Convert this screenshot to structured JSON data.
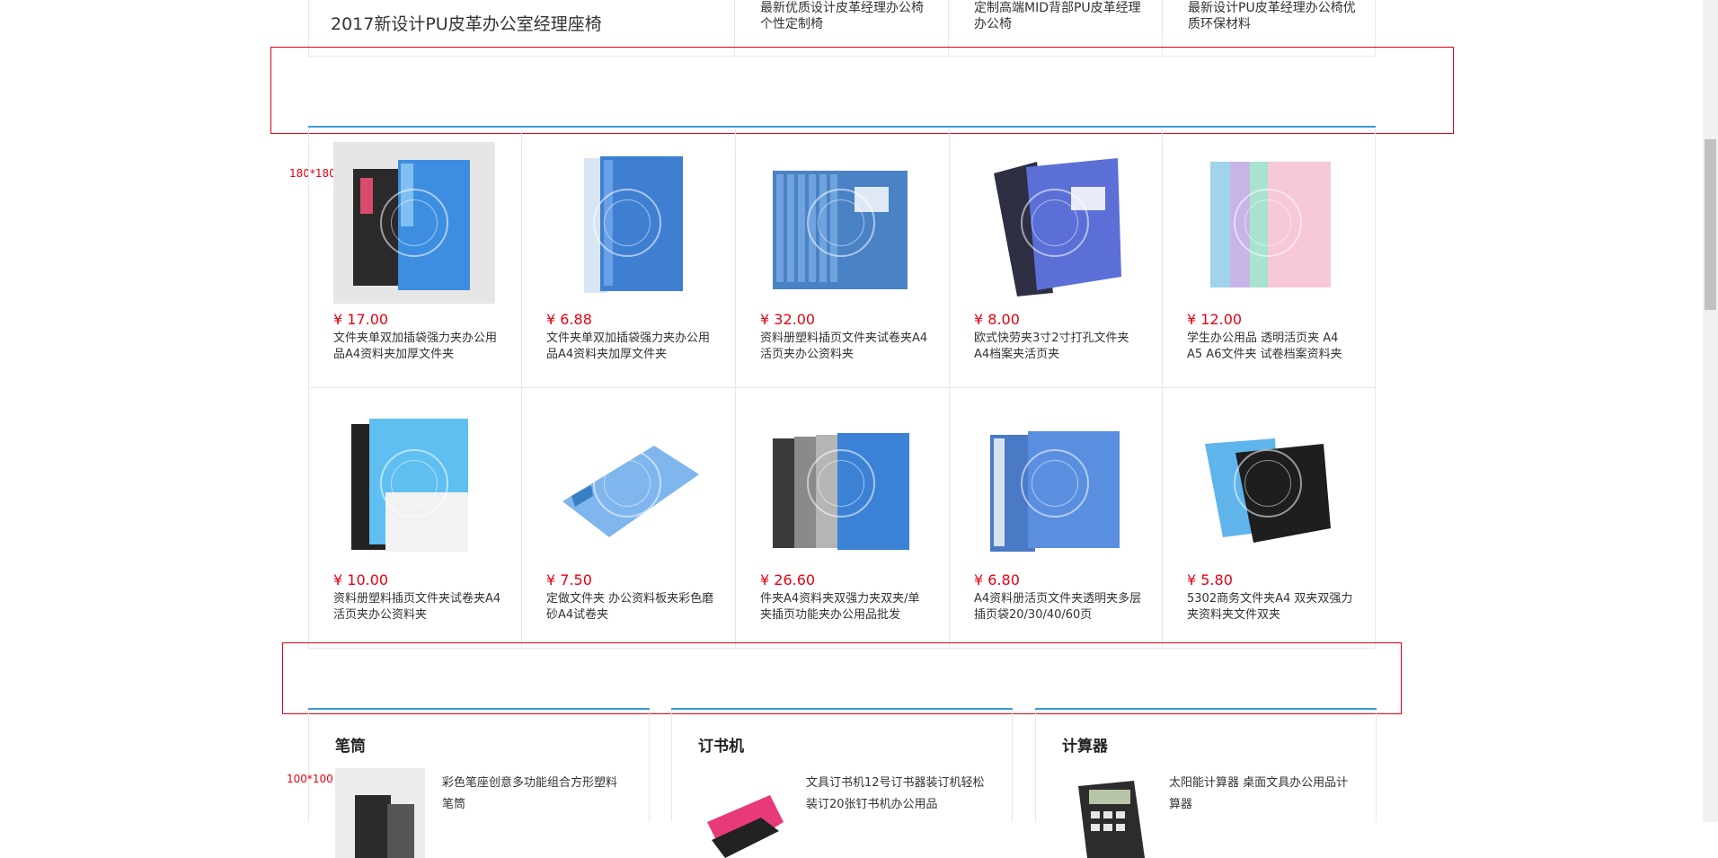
{
  "top_row": {
    "main_title": "2017新设计PU皮革办公室经理座椅",
    "items": [
      "最新优质设计皮革经理办公椅个性定制椅",
      "定制高端MID背部PU皮革经理办公椅",
      "最新设计PU皮革经理办公椅优质环保材料"
    ]
  },
  "labels": {
    "big": "180*180",
    "small": "100*100"
  },
  "products": [
    {
      "price": "¥ 17.00",
      "title": "文件夹单双加插袋强力夹办公用品A4资料夹加厚文件夹"
    },
    {
      "price": "¥ 6.88",
      "title": "文件夹单双加插袋强力夹办公用品A4资料夹加厚文件夹"
    },
    {
      "price": "¥ 32.00",
      "title": "资料册塑料插页文件夹试卷夹A4活页夹办公资料夹"
    },
    {
      "price": "¥ 8.00",
      "title": "欧式快劳夹3寸2寸打孔文件夹A4档案夹活页夹"
    },
    {
      "price": "¥ 12.00",
      "title": "学生办公用品 透明活页夹 A4 A5 A6文件夹 试卷档案资料夹"
    },
    {
      "price": "¥ 10.00",
      "title": "资料册塑料插页文件夹试卷夹A4活页夹办公资料夹"
    },
    {
      "price": "¥ 7.50",
      "title": "定做文件夹 办公资料板夹彩色磨砂A4试卷夹"
    },
    {
      "price": "¥ 26.60",
      "title": "件夹A4资料夹双强力夹双夹/单夹插页功能夹办公用品批发"
    },
    {
      "price": "¥ 6.80",
      "title": "A4资料册活页文件夹透明夹多层插页袋20/30/40/60页"
    },
    {
      "price": "¥ 5.80",
      "title": "5302商务文件夹A4 双夹双强力夹资料夹文件双夹"
    }
  ],
  "categories": [
    {
      "name": "笔筒",
      "desc": "彩色笔座创意多功能组合方形塑料笔筒"
    },
    {
      "name": "订书机",
      "desc": "文具订书机12号订书器装订机轻松装订20张钉书机办公用品"
    },
    {
      "name": "计算器",
      "desc": "太阳能计算器 桌面文具办公用品计算器"
    }
  ],
  "colors": {
    "price": "#e60012",
    "accent_line": "#3a9ad9",
    "red_box": "#e60012",
    "border": "#e8e8e8"
  }
}
